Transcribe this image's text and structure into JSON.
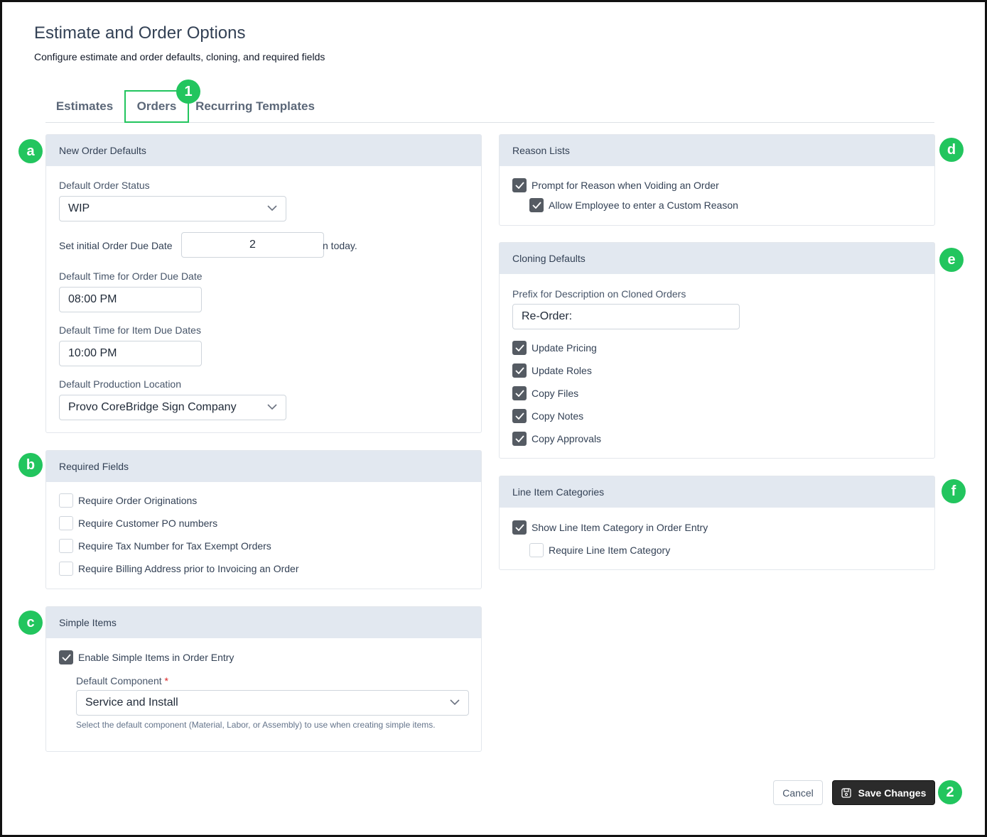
{
  "page": {
    "title": "Estimate and Order Options",
    "subtitle": "Configure estimate and order defaults, cloning, and required fields"
  },
  "tabs": [
    {
      "label": "Estimates",
      "active": false
    },
    {
      "label": "Orders",
      "active": true
    },
    {
      "label": "Recurring Templates",
      "active": false
    }
  ],
  "badges": {
    "tab": "1",
    "save": "2",
    "a": "a",
    "b": "b",
    "c": "c",
    "d": "d",
    "e": "e",
    "f": "f"
  },
  "new_order_defaults": {
    "title": "New Order Defaults",
    "status_label": "Default Order Status",
    "status_value": "WIP",
    "due_prefix": "Set initial Order Due Date",
    "due_value": "2",
    "due_suffix": "n today.",
    "order_time_label": "Default Time for Order Due Date",
    "order_time_value": "08:00 PM",
    "item_time_label": "Default Time for Item Due Dates",
    "item_time_value": "10:00 PM",
    "location_label": "Default Production Location",
    "location_value": "Provo CoreBridge Sign Company"
  },
  "required_fields": {
    "title": "Required Fields",
    "items": [
      {
        "label": "Require Order Originations",
        "checked": false
      },
      {
        "label": "Require Customer PO numbers",
        "checked": false
      },
      {
        "label": "Require Tax Number for Tax Exempt Orders",
        "checked": false
      },
      {
        "label": "Require Billing Address prior to Invoicing an Order",
        "checked": false
      }
    ]
  },
  "simple_items": {
    "title": "Simple Items",
    "enable_label": "Enable Simple Items in Order Entry",
    "enable_checked": true,
    "component_label": "Default Component",
    "required_mark": "*",
    "component_value": "Service and Install",
    "hint": "Select the default component (Material, Labor, or Assembly) to use when creating simple items."
  },
  "reason_lists": {
    "title": "Reason Lists",
    "prompt_label": "Prompt for Reason when Voiding an Order",
    "prompt_checked": true,
    "custom_label": "Allow Employee to enter a Custom Reason",
    "custom_checked": true
  },
  "cloning_defaults": {
    "title": "Cloning Defaults",
    "prefix_label": "Prefix for Description on Cloned Orders",
    "prefix_value": "Re-Order:",
    "items": [
      {
        "label": "Update Pricing",
        "checked": true
      },
      {
        "label": "Update Roles",
        "checked": true
      },
      {
        "label": "Copy Files",
        "checked": true
      },
      {
        "label": "Copy Notes",
        "checked": true
      },
      {
        "label": "Copy Approvals",
        "checked": true
      }
    ]
  },
  "line_item_categories": {
    "title": "Line Item Categories",
    "show_label": "Show Line Item Category in Order Entry",
    "show_checked": true,
    "require_label": "Require Line Item Category",
    "require_checked": false
  },
  "actions": {
    "cancel_label": "Cancel",
    "save_label": "Save Changes"
  },
  "colors": {
    "accent": "#22c55e",
    "header_bg": "#e2e8f0",
    "checked_bg": "#555b63",
    "save_bg": "#2b2b2b"
  },
  "icons": {
    "check": "check-icon",
    "chevron": "chevron-down-icon",
    "save": "floppy-disk-icon"
  }
}
